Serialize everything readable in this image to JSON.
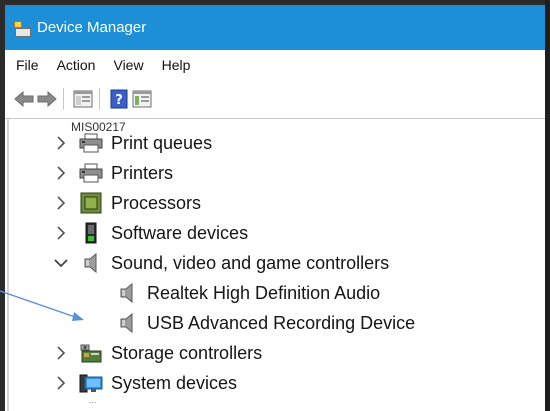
{
  "window": {
    "title": "Device Manager"
  },
  "menu": [
    "File",
    "Action",
    "View",
    "Help"
  ],
  "toolbar": {
    "buttons": [
      "back-icon",
      "forward-icon",
      "show-hide-console-tree-icon",
      "help-icon",
      "properties-icon"
    ]
  },
  "tree": {
    "computer_partial": "MIS00217",
    "bottom_partial": "...",
    "items": [
      {
        "label": "Print queues",
        "icon": "printer-icon",
        "expanded": false
      },
      {
        "label": "Printers",
        "icon": "printer-icon",
        "expanded": false
      },
      {
        "label": "Processors",
        "icon": "processor-icon",
        "expanded": false
      },
      {
        "label": "Software devices",
        "icon": "software-device-icon",
        "expanded": false
      },
      {
        "label": "Sound, video and game controllers",
        "icon": "speaker-icon",
        "expanded": true
      },
      {
        "label": "Realtek High Definition Audio",
        "icon": "speaker-icon",
        "child": true
      },
      {
        "label": "USB Advanced Recording Device",
        "icon": "speaker-icon",
        "child": true
      },
      {
        "label": "Storage controllers",
        "icon": "storage-controller-icon",
        "expanded": false
      },
      {
        "label": "System devices",
        "icon": "system-devices-icon",
        "expanded": false
      }
    ]
  },
  "colors": {
    "titlebar": "#1d8fd6",
    "arrow": "#5b8fd4"
  }
}
